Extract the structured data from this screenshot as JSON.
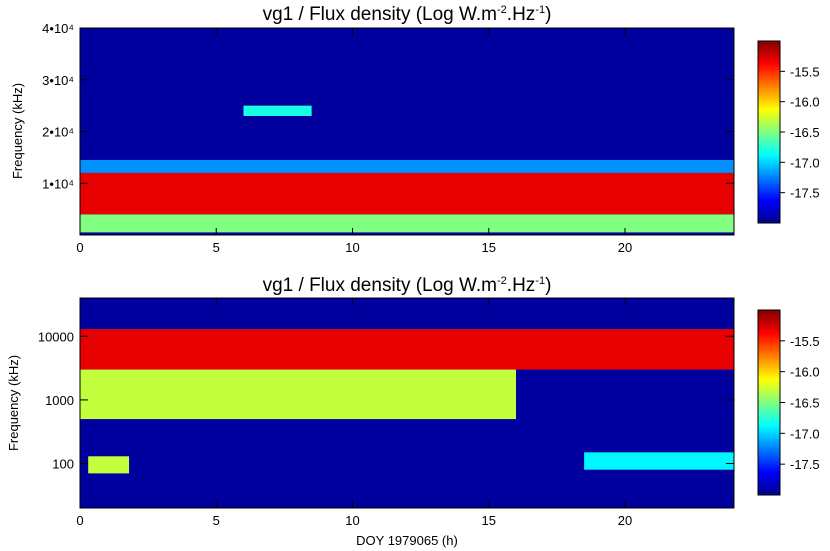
{
  "chart_data": [
    {
      "type": "heatmap",
      "title_main": "vg1 / Flux density (Log W.m",
      "title_exp1": "-2",
      "title_mid": ".Hz",
      "title_exp2": "-1",
      "title_end": ")",
      "ylabel": "Frequency (kHz)",
      "xlabel": "",
      "y_scale": "linear",
      "xlim": [
        0,
        24
      ],
      "ylim": [
        0,
        40000
      ],
      "x_ticks": [
        0,
        5,
        10,
        15,
        20
      ],
      "x_tick_labels": [
        "0",
        "5",
        "10",
        "15",
        "20"
      ],
      "y_ticks": [
        10000,
        20000,
        30000,
        40000
      ],
      "y_tick_labels": [
        "1•10⁴",
        "2•10⁴",
        "3•10⁴",
        "4•10⁴"
      ],
      "colorbar": {
        "range": [
          -18.0,
          -15.0
        ],
        "ticks": [
          -15.5,
          -16.0,
          -16.5,
          -17.0,
          -17.5
        ],
        "tick_labels": [
          "-15.5",
          "-16.0",
          "-16.5",
          "-17.0",
          "-17.5"
        ]
      },
      "bands": [
        {
          "f_low": 500,
          "f_high": 4000,
          "x_start": 0,
          "x_end": 24,
          "level": -16.5
        },
        {
          "f_low": 4000,
          "f_high": 12000,
          "x_start": 0,
          "x_end": 24,
          "level": -15.3
        },
        {
          "f_low": 12000,
          "f_high": 14500,
          "x_start": 0,
          "x_end": 24,
          "level": -17.2
        },
        {
          "f_low": 23000,
          "f_high": 25000,
          "x_start": 6,
          "x_end": 8.5,
          "level": -16.8
        }
      ]
    },
    {
      "type": "heatmap",
      "title_main": "vg1 / Flux density (Log W.m",
      "title_exp1": "-2",
      "title_mid": ".Hz",
      "title_exp2": "-1",
      "title_end": ")",
      "ylabel": "Frequency (kHz)",
      "xlabel": "DOY 1979065 (h)",
      "y_scale": "log",
      "xlim": [
        0,
        24
      ],
      "ylim": [
        20,
        40000
      ],
      "x_ticks": [
        0,
        5,
        10,
        15,
        20
      ],
      "x_tick_labels": [
        "0",
        "5",
        "10",
        "15",
        "20"
      ],
      "y_ticks": [
        100,
        1000,
        10000
      ],
      "y_tick_labels": [
        "100",
        "1000",
        "10000"
      ],
      "colorbar": {
        "range": [
          -18.0,
          -15.0
        ],
        "ticks": [
          -15.5,
          -16.0,
          -16.5,
          -17.0,
          -17.5
        ],
        "tick_labels": [
          "-15.5",
          "-16.0",
          "-16.5",
          "-17.0",
          "-17.5"
        ]
      },
      "bands": [
        {
          "f_low": 3000,
          "f_high": 13000,
          "x_start": 0,
          "x_end": 24,
          "level": -15.3
        },
        {
          "f_low": 500,
          "f_high": 3000,
          "x_start": 0,
          "x_end": 16,
          "level": -16.3
        },
        {
          "f_low": 70,
          "f_high": 130,
          "x_start": 0.3,
          "x_end": 1.8,
          "level": -16.3
        },
        {
          "f_low": 80,
          "f_high": 150,
          "x_start": 18.5,
          "x_end": 24,
          "level": -16.9
        }
      ]
    }
  ]
}
